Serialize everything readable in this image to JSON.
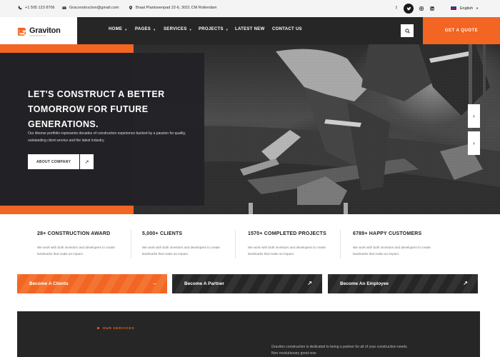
{
  "topbar": {
    "phone": "+1 505 123 8706",
    "email": "Graconstruction@gmail.com",
    "address": "Braat Plantsoenpad 22-6, 3021 CM Rotterdam",
    "language": "English",
    "social": [
      "f",
      "t",
      "ig",
      "in"
    ]
  },
  "header": {
    "logo_text": "Graviton",
    "logo_subtext": "CONSTRUCTION",
    "nav": [
      {
        "label": "HOME",
        "caret": true
      },
      {
        "label": "PAGES",
        "caret": true
      },
      {
        "label": "SERVICES",
        "caret": true
      },
      {
        "label": "PROJECTS",
        "caret": true
      },
      {
        "label": "LATEST NEW",
        "caret": false
      },
      {
        "label": "CONTACT US",
        "caret": false
      }
    ],
    "quote_label": "GET A QUOTE"
  },
  "hero": {
    "title": "LET'S CONSTRUCT A BETTER TOMORROW FOR FUTURE GENERATIONS.",
    "description": "Our diverse portfolio represents decades of construction experience backed by a passion for quality, outstanding client service and the latest industry.",
    "button_label": "ABOUT COMPANY",
    "prev_arrow": "‹",
    "next_arrow": "›"
  },
  "stats": [
    {
      "title": "28+ CONSTRUCTION AWARD",
      "desc": "We work with both investors and developers to create landmarks that make an impact."
    },
    {
      "title": "5,000+ CLIENTS",
      "desc": "We work with both investors and developers to create landmarks that make an impact."
    },
    {
      "title": "1570+ COMPLETED PROJECTS",
      "desc": "We work with both investors and developers to create landmarks that make an impact."
    },
    {
      "title": "6789+ HAPPY CUSTOMERS",
      "desc": "We work with both investors and developers to create landmarks that make an impact."
    }
  ],
  "cta": [
    {
      "label": "Become A Clients",
      "arrow": "→"
    },
    {
      "label": "Become A Partner",
      "arrow": "↗"
    },
    {
      "label": "Become An Employee",
      "arrow": "↗"
    }
  ],
  "services": {
    "label": "OUR SERVICES",
    "heading_fragment": "",
    "paragraph": "Graviton construction is dedicated to being a partner for all of your construction needs. Non revolutionary great now"
  },
  "colors": {
    "accent": "#f26522",
    "dark": "#262626"
  }
}
